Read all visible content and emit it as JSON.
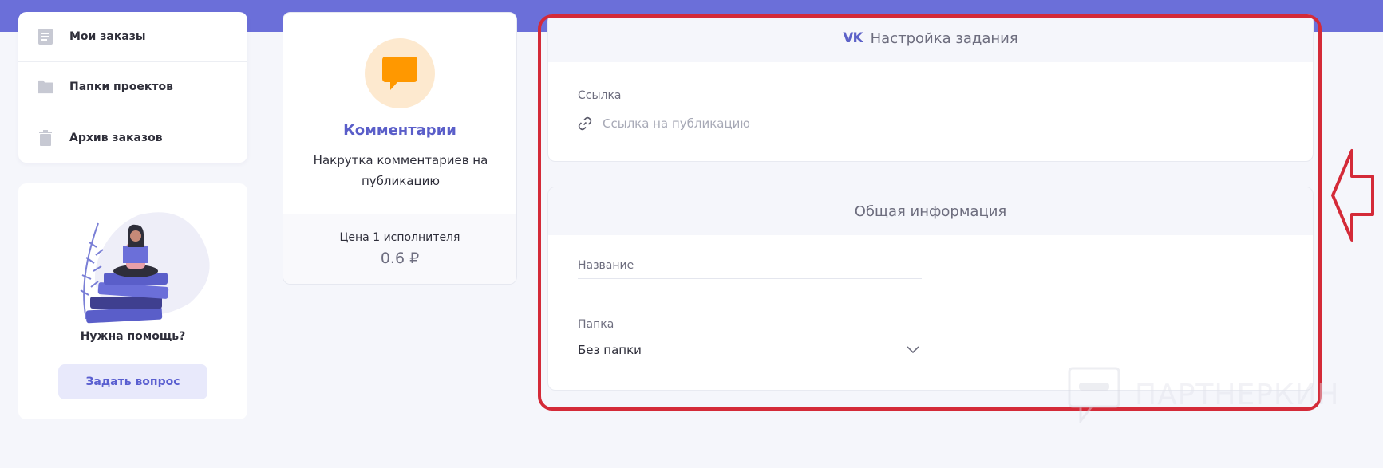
{
  "sidebar": {
    "items": [
      {
        "label": "Мои заказы",
        "icon": "document-icon"
      },
      {
        "label": "Папки проектов",
        "icon": "folder-icon"
      },
      {
        "label": "Архив заказов",
        "icon": "trash-icon"
      }
    ]
  },
  "help": {
    "title": "Нужна помощь?",
    "button_label": "Задать вопрос"
  },
  "service": {
    "title": "Комментарии",
    "description": "Накрутка комментариев на публикацию",
    "price_label": "Цена 1 исполнителя",
    "price_value": "0.6 ₽",
    "icon": "comment-icon"
  },
  "task_settings": {
    "header": "Настройка задания",
    "network_icon": "vk-icon",
    "link_label": "Ссылка",
    "link_placeholder": "Ссылка на публикацию",
    "link_value": ""
  },
  "general_info": {
    "header": "Общая информация",
    "name_label": "Название",
    "folder_label": "Папка",
    "folder_value": "Без папки"
  },
  "watermark": "ПАРТНЕРКИН",
  "colors": {
    "accent": "#6b6fd9",
    "highlight": "#d42a38",
    "service_title": "#5a5ec9",
    "service_icon": "#ff9800"
  }
}
